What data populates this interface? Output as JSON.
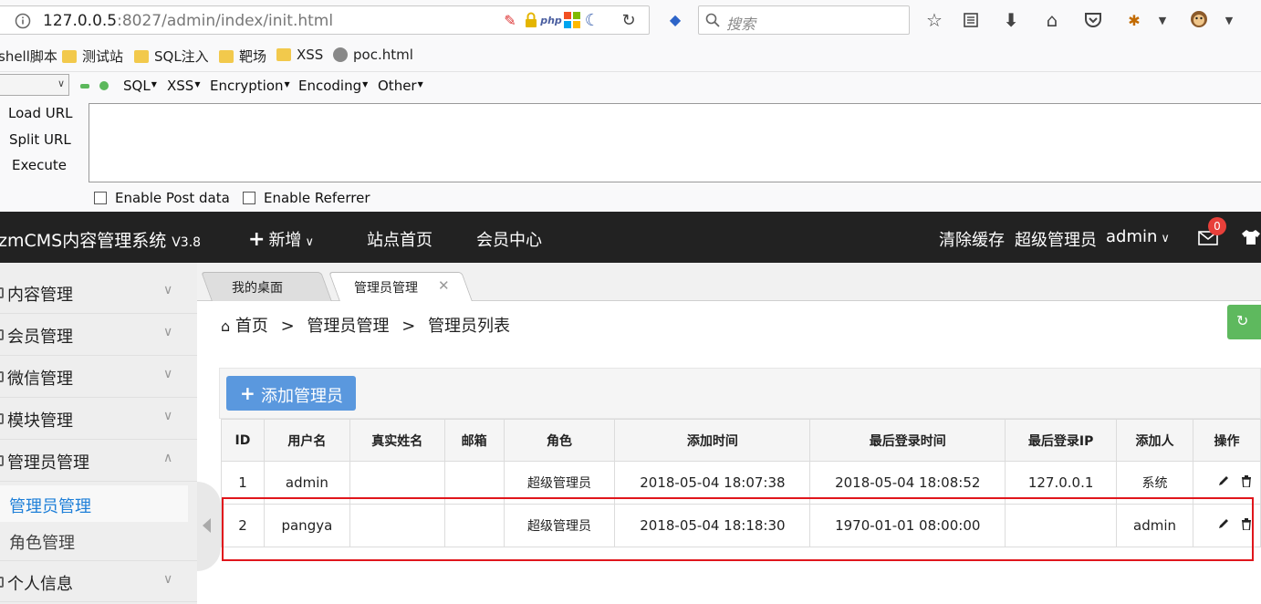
{
  "browser": {
    "url_host": "127.0.0.5",
    "url_rest": ":8027/admin/index/init.html",
    "search_placeholder": "搜索",
    "addon_php_label": "php"
  },
  "bookmarks": [
    {
      "label": "shell脚本",
      "icon": "folder-icon"
    },
    {
      "label": "测试站",
      "icon": "folder-icon"
    },
    {
      "label": "SQL注入",
      "icon": "folder-icon"
    },
    {
      "label": "靶场",
      "icon": "folder-icon"
    },
    {
      "label": "XSS",
      "icon": "folder-icon"
    },
    {
      "label": "poc.html",
      "icon": "globe-icon"
    }
  ],
  "hackbar": {
    "menus": [
      "SQL",
      "XSS",
      "Encryption",
      "Encoding",
      "Other"
    ],
    "load_url": "Load URL",
    "split_url": "Split URL",
    "execute": "Execute",
    "enable_post": "Enable Post data",
    "enable_referrer": "Enable Referrer"
  },
  "app": {
    "brand": "zmCMS内容管理系统",
    "version": "V3.8",
    "nav_new": "新增",
    "nav_home": "站点首页",
    "nav_member": "会员中心",
    "clear_cache": "清除缓存",
    "role": "超级管理员",
    "user": "admin",
    "mail_count": "0"
  },
  "sidebar": {
    "items": [
      {
        "label": "内容管理"
      },
      {
        "label": "会员管理"
      },
      {
        "label": "微信管理"
      },
      {
        "label": "模块管理"
      },
      {
        "label": "管理员管理"
      },
      {
        "label": "个人信息"
      }
    ],
    "sub_items": [
      {
        "label": "管理员管理",
        "active": true
      },
      {
        "label": "角色管理",
        "active": false
      }
    ]
  },
  "tabs": [
    {
      "label": "我的桌面"
    },
    {
      "label": "管理员管理"
    }
  ],
  "breadcrumb": [
    "首页",
    "管理员管理",
    "管理员列表"
  ],
  "add_button": "添加管理员",
  "table": {
    "headers": [
      "ID",
      "用户名",
      "真实姓名",
      "邮箱",
      "角色",
      "添加时间",
      "最后登录时间",
      "最后登录IP",
      "添加人",
      "操作"
    ],
    "rows": [
      [
        "1",
        "admin",
        "",
        "",
        "超级管理员",
        "2018-05-04 18:07:38",
        "2018-05-04 18:08:52",
        "127.0.0.1",
        "系统"
      ],
      [
        "2",
        "pangya",
        "",
        "",
        "超级管理员",
        "2018-05-04 18:18:30",
        "1970-01-01 08:00:00",
        "",
        "admin"
      ]
    ]
  },
  "colors": {
    "header_bg": "#222222",
    "accent_blue": "#5a98de",
    "refresh_green": "#5eb95e",
    "highlight_red": "#e0161c",
    "badge_red": "#e8403a"
  }
}
